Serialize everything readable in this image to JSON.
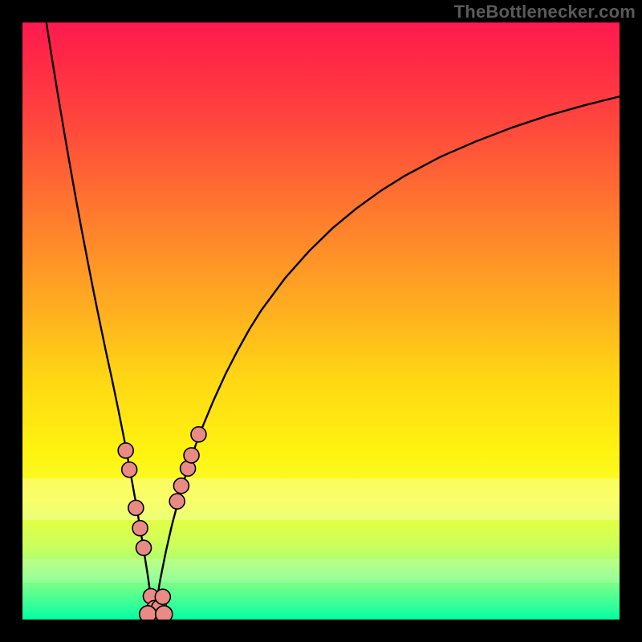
{
  "watermark": {
    "text": "TheBottlenecker.com"
  },
  "colors": {
    "frame": "#000000",
    "curve": "#000000",
    "dot_fill": "#e98a84",
    "dot_stroke": "#000000"
  },
  "chart_data": {
    "type": "line",
    "title": "",
    "xlabel": "",
    "ylabel": "",
    "xlim": [
      0,
      100
    ],
    "ylim": [
      0,
      100
    ],
    "grid": false,
    "legend": false,
    "minimum_x": 22,
    "series": [
      {
        "name": "curve-left",
        "x": [
          4,
          5,
          6,
          7,
          8,
          9,
          10,
          11,
          12,
          13,
          14,
          15,
          16,
          17,
          18,
          19,
          20,
          21,
          22
        ],
        "y": [
          100,
          93.6,
          87.5,
          81.6,
          75.8,
          70.2,
          64.8,
          59.6,
          54.5,
          49.6,
          44.8,
          40.2,
          35.4,
          30.4,
          25.1,
          19.5,
          13.6,
          7.3,
          0
        ]
      },
      {
        "name": "curve-right",
        "x": [
          22,
          23,
          24,
          25,
          26,
          27,
          28,
          29,
          30,
          32,
          34,
          36,
          38,
          40,
          44,
          48,
          52,
          56,
          60,
          64,
          70,
          76,
          82,
          88,
          94,
          100
        ],
        "y": [
          0,
          6.3,
          11.3,
          15.7,
          19.5,
          23.1,
          26.2,
          29.2,
          31.9,
          36.7,
          41.1,
          45,
          48.6,
          51.8,
          57.2,
          61.7,
          65.6,
          68.9,
          71.8,
          74.3,
          77.5,
          80.1,
          82.4,
          84.4,
          86.1,
          87.6
        ]
      }
    ],
    "dots_left": [
      {
        "x": 17.3,
        "y": 28.3
      },
      {
        "x": 17.9,
        "y": 25.1
      },
      {
        "x": 19.0,
        "y": 18.7
      },
      {
        "x": 19.7,
        "y": 15.3
      },
      {
        "x": 20.3,
        "y": 12.0
      },
      {
        "x": 21.5,
        "y": 3.9
      },
      {
        "x": 22.1,
        "y": 1.9
      }
    ],
    "dots_right": [
      {
        "x": 22.9,
        "y": 2.0
      },
      {
        "x": 23.5,
        "y": 3.8
      },
      {
        "x": 25.9,
        "y": 19.8
      },
      {
        "x": 26.6,
        "y": 22.4
      },
      {
        "x": 27.7,
        "y": 25.3
      },
      {
        "x": 28.3,
        "y": 27.5
      },
      {
        "x": 29.5,
        "y": 31.0
      }
    ],
    "dots_bottom": [
      {
        "x": 21.0,
        "y": 0.9
      },
      {
        "x": 23.7,
        "y": 0.9
      }
    ]
  }
}
